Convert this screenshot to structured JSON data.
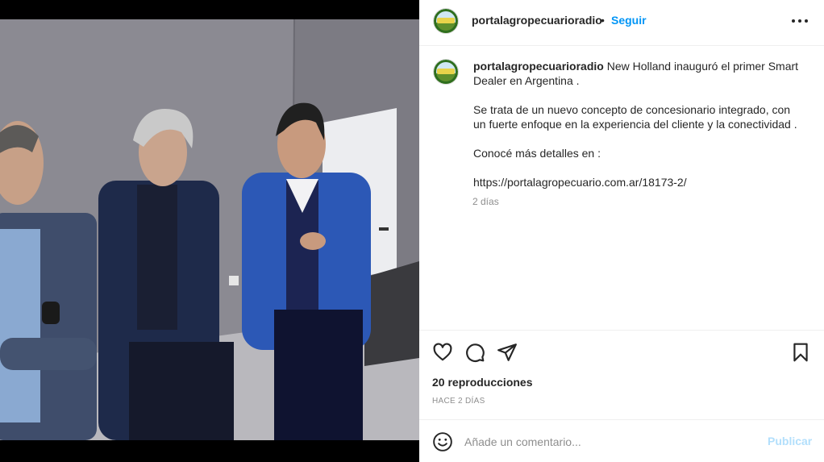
{
  "post": {
    "username": "portalagropecuarioradio",
    "separator": "•",
    "follow_label": "Seguir",
    "more_icon": "more-horizontal-icon"
  },
  "caption": {
    "username": "portalagropecuarioradio",
    "line1": "New Holland inauguró el primer Smart Dealer en Argentina .",
    "line2": "Se trata de un nuevo concepto de concesionario integrado, con un fuerte enfoque en la experiencia del cliente y la conectividad .",
    "line3": "Conocé más detalles en :",
    "link": "https://portalagropecuario.com.ar/18173-2/",
    "time": "2 días"
  },
  "actions": {
    "icons": [
      "heart-icon",
      "comment-icon",
      "share-icon",
      "bookmark-icon"
    ],
    "views": "20 reproducciones",
    "ago": "HACE 2 DÍAS"
  },
  "comment": {
    "placeholder": "Añade un comentario...",
    "publish_label": "Publicar"
  },
  "colors": {
    "accent": "#0095f6",
    "publish_disabled": "#b2dffc",
    "muted": "#8e8e8e"
  }
}
